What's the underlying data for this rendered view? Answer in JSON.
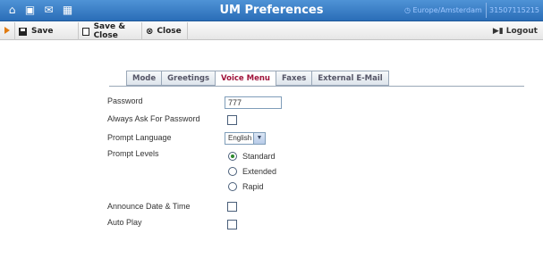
{
  "window": {
    "title": "UM Preferences",
    "timezone": "Europe/Amsterdam",
    "account_id": "31507115215",
    "icons": [
      "home-icon",
      "grid-icon",
      "mail-icon",
      "calendar-icon"
    ]
  },
  "toolbar": {
    "save_label": "Save",
    "save_close_label": "Save & Close",
    "close_label": "Close",
    "logout_label": "Logout"
  },
  "tabs": [
    {
      "label": "Mode",
      "active": false
    },
    {
      "label": "Greetings",
      "active": false
    },
    {
      "label": "Voice Menu",
      "active": true
    },
    {
      "label": "Faxes",
      "active": false
    },
    {
      "label": "External E-Mail",
      "active": false
    }
  ],
  "form": {
    "password_label": "Password",
    "password_value": "777",
    "always_ask_label": "Always Ask For Password",
    "always_ask_checked": false,
    "prompt_language_label": "Prompt Language",
    "prompt_language_value": "English",
    "prompt_levels_label": "Prompt Levels",
    "prompt_levels_options": [
      "Standard",
      "Extended",
      "Rapid"
    ],
    "prompt_levels_selected": "Standard",
    "announce_label": "Announce Date & Time",
    "announce_checked": false,
    "autoplay_label": "Auto Play",
    "autoplay_checked": false
  },
  "colors": {
    "titlebar": "#2a6db7",
    "active_tab_text": "#a0143c",
    "radio_selected": "#2d8a2d"
  }
}
